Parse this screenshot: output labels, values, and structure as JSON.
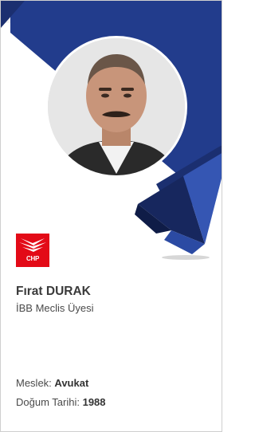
{
  "member": {
    "name": "Fırat DURAK",
    "title": "İBB Meclis Üyesi",
    "profession_label": "Meslek:",
    "profession_value": "Avukat",
    "birth_label": "Doğum Tarihi:",
    "birth_value": "1988"
  },
  "party": {
    "logo_text": "CHP",
    "color": "#e30a17"
  },
  "colors": {
    "banner_dark": "#17275e",
    "banner_main": "#223c8c",
    "banner_light": "#3556b3",
    "text": "#3a3a3a"
  },
  "icons": {
    "party_logo": "chp-six-arrows-icon",
    "photo": "member-portrait"
  }
}
